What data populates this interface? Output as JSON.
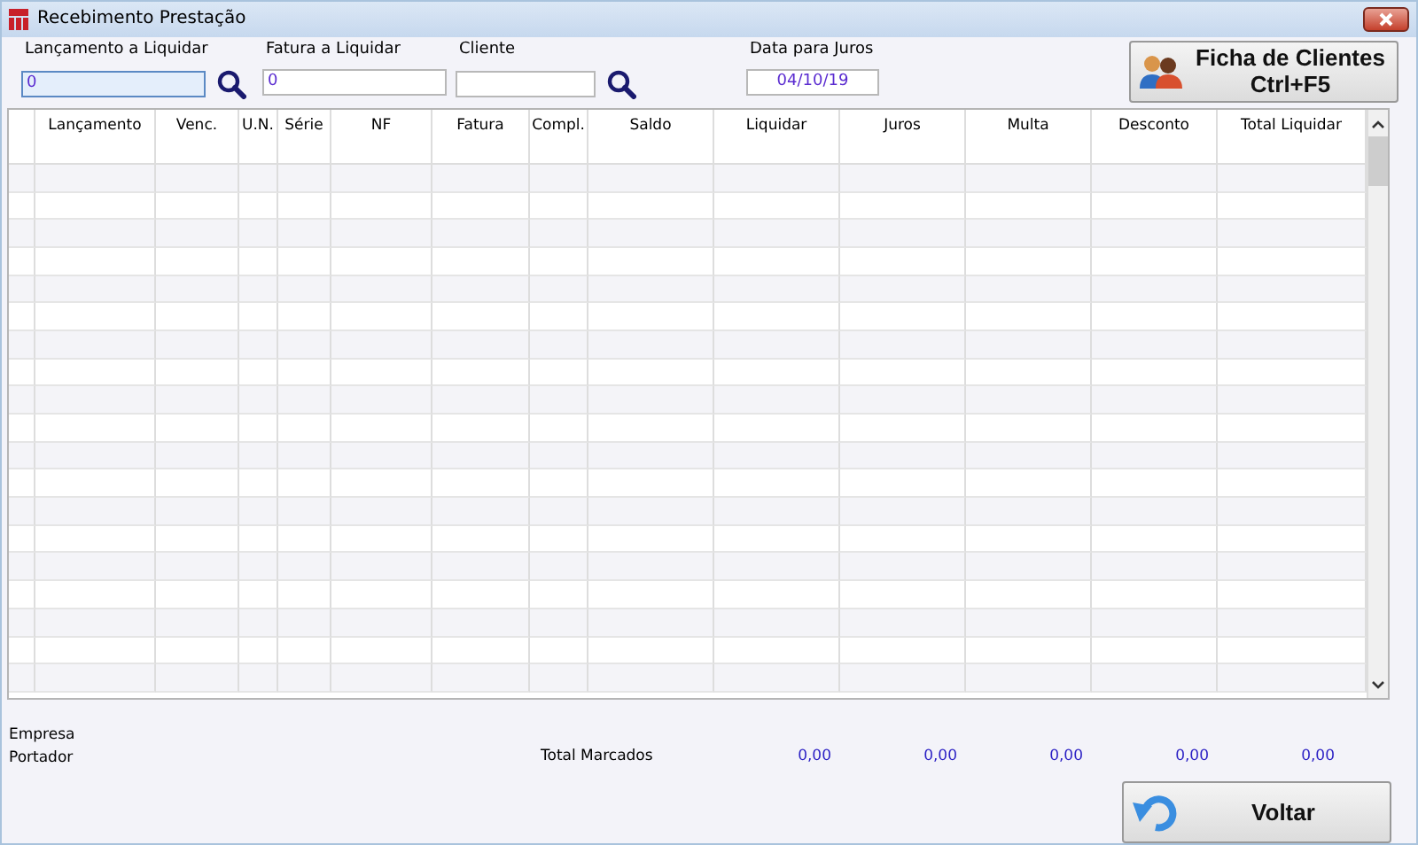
{
  "window": {
    "title": "Recebimento Prestação"
  },
  "filters": [
    {
      "label": "Lançamento a Liquidar",
      "value": "0",
      "focused": true,
      "search": true
    },
    {
      "label": "Fatura a Liquidar",
      "value": "0",
      "focused": false,
      "search": false
    },
    {
      "label": "Cliente",
      "focused": false,
      "search": true
    }
  ],
  "interest_date": {
    "label": "Data para Juros",
    "value": "04/10/19"
  },
  "client_button": {
    "line_1": "Ficha de Clientes",
    "line_2": "Ctrl+F5"
  },
  "table": {
    "columns": [
      "Lançamento",
      "Venc.",
      "U.N.",
      "Série",
      "NF",
      "Fatura",
      "Compl.",
      "Saldo",
      "Liquidar",
      "Juros",
      "Multa",
      "Desconto",
      "Total Liquidar"
    ]
  },
  "footer": {
    "labels": [
      "Empresa",
      "Portador"
    ],
    "total_label": "Total Marcados",
    "totals": [
      "0,00",
      "0,00",
      "0,00",
      "0,00",
      "0,00"
    ]
  },
  "back_button": {
    "label": "Voltar"
  }
}
